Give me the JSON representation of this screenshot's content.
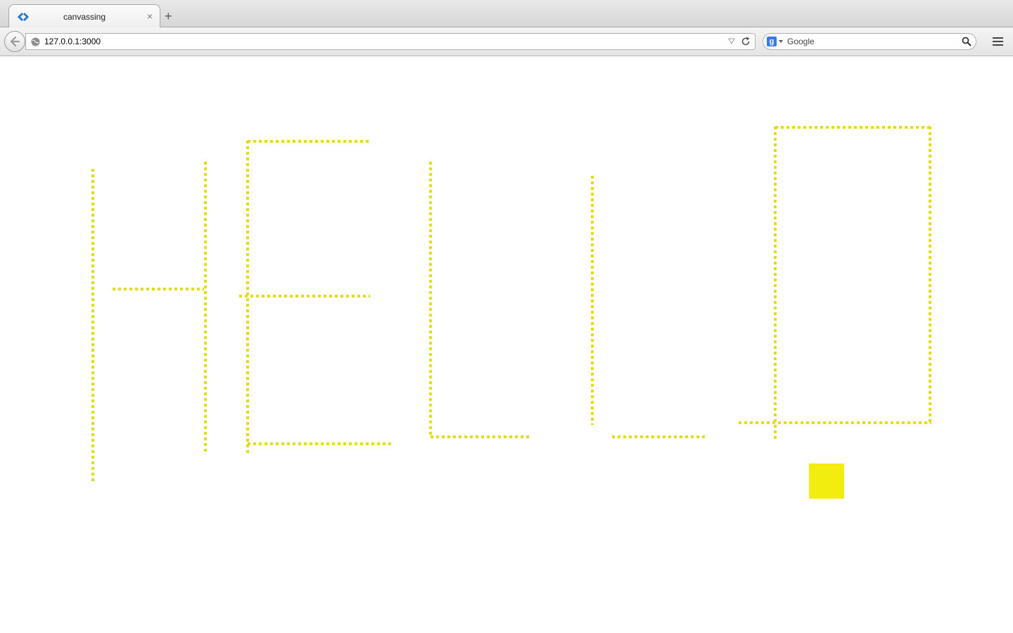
{
  "browser": {
    "tab": {
      "title": "canvassing",
      "close_label": "×",
      "favicon": "blue-diamond-icon"
    },
    "new_tab_label": "+",
    "url": "127.0.0.1:3000",
    "search": {
      "engine": "Google",
      "engine_glyph": "g",
      "placeholder": "Google"
    }
  },
  "canvas": {
    "stroke_color": "#e8dd0c",
    "fill_color": "#f2ec0f",
    "drawing": "HELLO"
  }
}
